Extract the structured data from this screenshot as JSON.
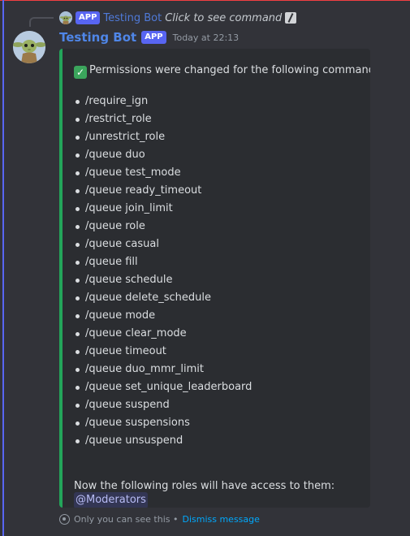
{
  "reply": {
    "app_tag": "APP",
    "name": "Testing Bot",
    "hint": "Click to see command"
  },
  "message": {
    "author": "Testing Bot",
    "app_tag": "APP",
    "timestamp": "Today at 22:13"
  },
  "embed": {
    "intro": "Permissions were changed for the following commands:",
    "commands": [
      "/require_ign",
      "/restrict_role",
      "/unrestrict_role",
      "/queue duo",
      "/queue test_mode",
      "/queue ready_timeout",
      "/queue join_limit",
      "/queue role",
      "/queue casual",
      "/queue fill",
      "/queue schedule",
      "/queue delete_schedule",
      "/queue mode",
      "/queue clear_mode",
      "/queue timeout",
      "/queue duo_mmr_limit",
      "/queue set_unique_leaderboard",
      "/queue suspend",
      "/queue suspensions",
      "/queue unsuspend"
    ],
    "outro": "Now the following roles will have access to them:",
    "mention": "@Moderators",
    "accent_color": "#23a55a"
  },
  "ephemeral": {
    "notice": "Only you can see this •",
    "dismiss_label": "Dismiss message"
  },
  "icons": {
    "check": "white-check-mark-icon",
    "eye": "eye-icon",
    "slash": "slash-command-icon"
  }
}
